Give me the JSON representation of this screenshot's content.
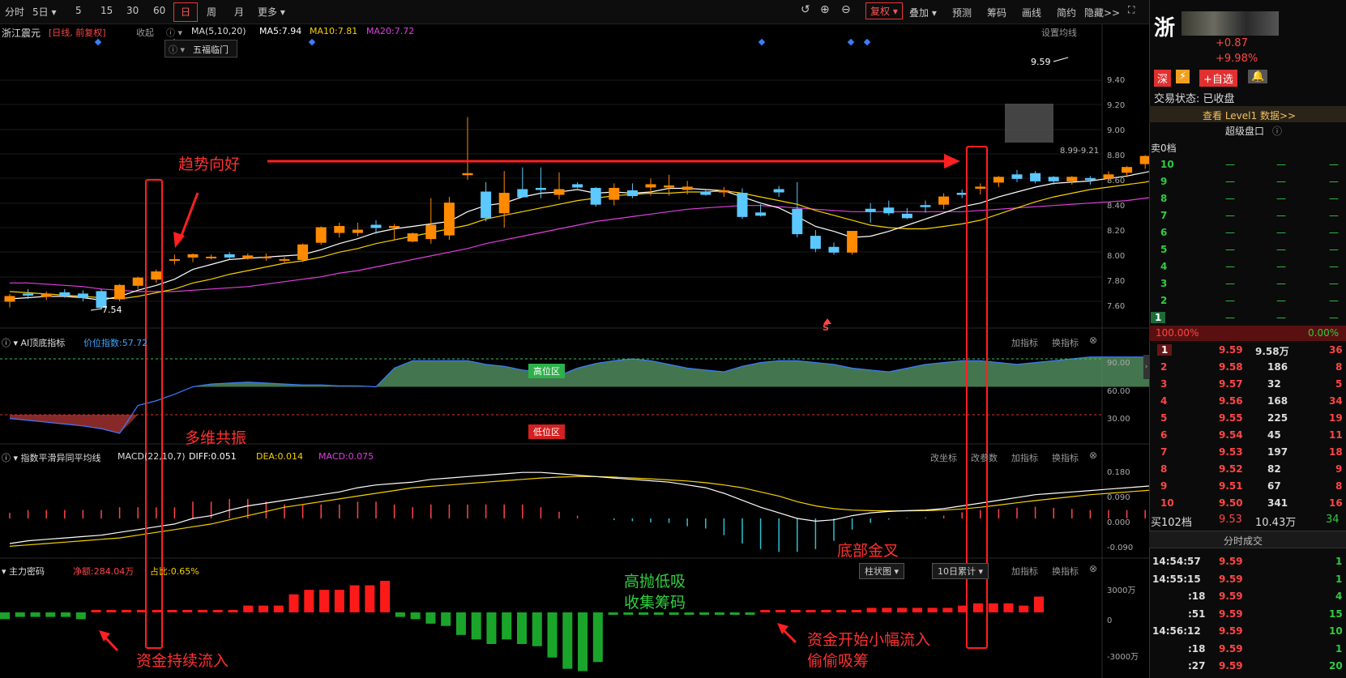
{
  "toolbar": {
    "time_share": "分时",
    "five_day": "5日",
    "m5": "5",
    "m15": "15",
    "m30": "30",
    "m60": "60",
    "day": "日",
    "week": "周",
    "month": "月",
    "more": "更多",
    "fuquan": "复权",
    "overlay": "叠加",
    "predict": "预测",
    "chips": "筹码",
    "draw": "画线",
    "simple": "简约",
    "hide": "隐藏>>"
  },
  "main_chart": {
    "stock_name": "浙江震元",
    "period_note": "[日线, 前复权]",
    "collapse": "收起",
    "ma_label": "MA(5,10,20)",
    "ma5": "MA5:7.94",
    "ma10": "MA10:7.81",
    "ma20": "MA20:7.72",
    "set_ma": "设置均线",
    "wufu": "五福临门",
    "high_label": "9.59",
    "low_label": "7.54",
    "range_label": "8.99-9.21",
    "s_mark": "S",
    "y_ticks": [
      "9.40",
      "9.20",
      "9.00",
      "8.80",
      "8.60",
      "8.40",
      "8.20",
      "8.00",
      "7.80",
      "7.60"
    ]
  },
  "ai_panel": {
    "title": "AI顶底指标",
    "value": "价位指数:57.72",
    "high_zone": "高位区",
    "low_zone": "低位区",
    "add_indicator": "加指标",
    "change_indicator": "换指标",
    "y_ticks": [
      "90.00",
      "60.00",
      "30.00"
    ]
  },
  "macd_panel": {
    "title": "指数平滑异同平均线",
    "param": "MACD(22,10,7)",
    "diff": "DIFF:0.051",
    "dea": "DEA:0.014",
    "macd": "MACD:0.075",
    "change_axis": "改坐标",
    "change_param": "改参数",
    "add_indicator": "加指标",
    "change_indicator": "换指标",
    "y_ticks": [
      "0.180",
      "0.090",
      "0.000",
      "-0.090"
    ]
  },
  "money_panel": {
    "title": "主力密码",
    "net": "净额:284.04万",
    "ratio": "占比:0.65%",
    "bar_select": "柱状图",
    "days_select": "10日累计",
    "add_indicator": "加指标",
    "change_indicator": "换指标",
    "y_ticks": [
      "3000万",
      "0",
      "-3000万"
    ]
  },
  "annotations": {
    "trend": "趋势向好",
    "resonance": "多维共振",
    "inflow": "资金持续流入",
    "high_low_1": "高抛低吸",
    "high_low_2": "收集筹码",
    "golden_cross": "底部金叉",
    "small_inflow_1": "资金开始小幅流入",
    "small_inflow_2": "偷偷吸筹"
  },
  "chart_data": {
    "type": "line",
    "ma_series": [
      {
        "name": "MA5",
        "color": "#ffffff"
      },
      {
        "name": "MA10",
        "color": "#f5d000"
      },
      {
        "name": "MA20",
        "color": "#e040e0"
      }
    ],
    "candles_ohlc": [
      [
        7.6,
        7.66,
        7.55,
        7.64
      ],
      [
        7.66,
        7.7,
        7.62,
        7.65
      ],
      [
        7.64,
        7.68,
        7.61,
        7.66
      ],
      [
        7.67,
        7.7,
        7.63,
        7.65
      ],
      [
        7.66,
        7.69,
        7.6,
        7.63
      ],
      [
        7.68,
        7.7,
        7.54,
        7.55
      ],
      [
        7.62,
        7.74,
        7.6,
        7.73
      ],
      [
        7.73,
        7.8,
        7.7,
        7.79
      ],
      [
        7.78,
        7.86,
        7.75,
        7.84
      ],
      [
        7.94,
        7.98,
        7.9,
        7.94
      ],
      [
        7.96,
        7.99,
        7.92,
        7.98
      ],
      [
        7.96,
        7.98,
        7.94,
        7.96
      ],
      [
        7.98,
        8.0,
        7.94,
        7.96
      ],
      [
        7.95,
        7.99,
        7.94,
        7.97
      ],
      [
        7.96,
        7.99,
        7.93,
        7.96
      ],
      [
        7.94,
        7.96,
        7.91,
        7.94
      ],
      [
        7.94,
        8.07,
        7.92,
        8.06
      ],
      [
        8.08,
        8.21,
        8.06,
        8.2
      ],
      [
        8.16,
        8.24,
        8.12,
        8.21
      ],
      [
        8.16,
        8.24,
        8.13,
        8.18
      ],
      [
        8.22,
        8.26,
        8.15,
        8.2
      ],
      [
        8.2,
        8.23,
        8.1,
        8.21
      ],
      [
        8.09,
        8.16,
        8.08,
        8.15
      ],
      [
        8.11,
        8.44,
        8.07,
        8.22
      ],
      [
        8.14,
        8.45,
        8.1,
        8.4
      ],
      [
        8.63,
        9.1,
        8.59,
        8.64
      ],
      [
        8.49,
        8.57,
        8.25,
        8.28
      ],
      [
        8.32,
        8.66,
        8.2,
        8.48
      ],
      [
        8.51,
        8.69,
        8.46,
        8.45
      ],
      [
        8.52,
        8.69,
        8.44,
        8.51
      ],
      [
        8.47,
        8.65,
        8.43,
        8.51
      ],
      [
        8.55,
        8.57,
        8.52,
        8.53
      ],
      [
        8.52,
        8.53,
        8.37,
        8.39
      ],
      [
        8.43,
        8.56,
        8.38,
        8.52
      ],
      [
        8.5,
        8.56,
        8.44,
        8.46
      ],
      [
        8.53,
        8.6,
        8.46,
        8.55
      ],
      [
        8.53,
        8.63,
        8.46,
        8.54
      ],
      [
        8.51,
        8.58,
        8.47,
        8.53
      ],
      [
        8.49,
        8.51,
        8.46,
        8.47
      ],
      [
        8.49,
        8.53,
        8.45,
        8.5
      ],
      [
        8.48,
        8.52,
        8.27,
        8.29
      ],
      [
        8.32,
        8.39,
        8.29,
        8.3
      ],
      [
        8.51,
        8.54,
        8.45,
        8.49
      ],
      [
        8.35,
        8.57,
        8.12,
        8.15
      ],
      [
        8.13,
        8.18,
        8.0,
        8.03
      ],
      [
        8.04,
        8.08,
        7.98,
        8.0
      ],
      [
        8.0,
        8.17,
        7.98,
        8.17
      ],
      [
        8.35,
        8.4,
        8.24,
        8.33
      ],
      [
        8.36,
        8.42,
        8.3,
        8.32
      ],
      [
        8.31,
        8.36,
        8.27,
        8.28
      ],
      [
        8.38,
        8.42,
        8.32,
        8.37
      ],
      [
        8.39,
        8.48,
        8.35,
        8.45
      ],
      [
        8.48,
        8.51,
        8.44,
        8.47
      ],
      [
        8.52,
        8.56,
        8.47,
        8.53
      ],
      [
        8.57,
        8.62,
        8.53,
        8.61
      ],
      [
        8.63,
        8.67,
        8.57,
        8.6
      ],
      [
        8.64,
        8.66,
        8.56,
        8.58
      ],
      [
        8.61,
        8.62,
        8.55,
        8.58
      ],
      [
        8.58,
        8.62,
        8.55,
        8.61
      ],
      [
        8.6,
        8.62,
        8.55,
        8.59
      ],
      [
        8.6,
        8.66,
        8.58,
        8.63
      ],
      [
        8.65,
        8.7,
        8.61,
        8.69
      ],
      [
        8.72,
        8.79,
        8.68,
        8.78
      ],
      [
        8.84,
        8.87,
        8.71,
        8.74
      ],
      [
        8.86,
        8.9,
        8.66,
        8.73
      ],
      [
        9.59,
        9.59,
        9.21,
        9.21
      ]
    ],
    "ma5": [
      7.62,
      7.63,
      7.64,
      7.64,
      7.63,
      7.61,
      7.64,
      7.69,
      7.73,
      7.78,
      7.86,
      7.9,
      7.94,
      7.95,
      7.96,
      7.97,
      7.98,
      8.02,
      8.07,
      8.11,
      8.16,
      8.19,
      8.21,
      8.23,
      8.25,
      8.33,
      8.38,
      8.4,
      8.45,
      8.48,
      8.49,
      8.51,
      8.48,
      8.49,
      8.48,
      8.49,
      8.52,
      8.52,
      8.51,
      8.5,
      8.45,
      8.4,
      8.36,
      8.29,
      8.21,
      8.17,
      8.12,
      8.13,
      8.17,
      8.22,
      8.27,
      8.32,
      8.37,
      8.4,
      8.45,
      8.49,
      8.53,
      8.56,
      8.57,
      8.58,
      8.6,
      8.62,
      8.65,
      8.68,
      8.72,
      8.83
    ],
    "ma10": [
      7.68,
      7.67,
      7.66,
      7.65,
      7.64,
      7.63,
      7.62,
      7.64,
      7.67,
      7.7,
      7.75,
      7.78,
      7.82,
      7.85,
      7.88,
      7.91,
      7.93,
      7.96,
      8.0,
      8.03,
      8.07,
      8.1,
      8.13,
      8.16,
      8.19,
      8.22,
      8.27,
      8.3,
      8.33,
      8.36,
      8.39,
      8.42,
      8.44,
      8.46,
      8.47,
      8.48,
      8.48,
      8.49,
      8.49,
      8.5,
      8.48,
      8.45,
      8.42,
      8.39,
      8.34,
      8.3,
      8.26,
      8.22,
      8.2,
      8.19,
      8.19,
      8.21,
      8.23,
      8.26,
      8.31,
      8.36,
      8.41,
      8.45,
      8.48,
      8.51,
      8.53,
      8.55,
      8.57,
      8.6,
      8.64,
      8.68
    ],
    "ma20": [
      7.75,
      7.75,
      7.74,
      7.73,
      7.72,
      7.7,
      7.69,
      7.68,
      7.68,
      7.68,
      7.69,
      7.7,
      7.71,
      7.72,
      7.74,
      7.76,
      7.78,
      7.8,
      7.83,
      7.85,
      7.88,
      7.91,
      7.94,
      7.97,
      8.0,
      8.03,
      8.07,
      8.1,
      8.13,
      8.16,
      8.19,
      8.22,
      8.25,
      8.27,
      8.29,
      8.31,
      8.33,
      8.35,
      8.36,
      8.37,
      8.38,
      8.38,
      8.37,
      8.36,
      8.35,
      8.34,
      8.33,
      8.33,
      8.33,
      8.33,
      8.33,
      8.33,
      8.33,
      8.34,
      8.35,
      8.36,
      8.37,
      8.38,
      8.39,
      8.4,
      8.41,
      8.42,
      8.44,
      8.46,
      8.48,
      8.53
    ],
    "ai_index": [
      26,
      24,
      22,
      20,
      18,
      15,
      10,
      40,
      45,
      52,
      60,
      63,
      64,
      65,
      64,
      63,
      62,
      62,
      61,
      61,
      60,
      80,
      88,
      88,
      88,
      88,
      84,
      82,
      78,
      76,
      72,
      80,
      85,
      88,
      90,
      88,
      84,
      80,
      78,
      76,
      82,
      86,
      88,
      88,
      86,
      84,
      80,
      78,
      76,
      80,
      84,
      86,
      88,
      88,
      86,
      84,
      86,
      88,
      90,
      92,
      92,
      92,
      92,
      91,
      91,
      93
    ],
    "diff": [
      -0.09,
      -0.08,
      -0.075,
      -0.07,
      -0.065,
      -0.06,
      -0.05,
      -0.04,
      -0.03,
      -0.02,
      0.0,
      0.01,
      0.03,
      0.045,
      0.055,
      0.065,
      0.075,
      0.085,
      0.095,
      0.11,
      0.12,
      0.125,
      0.13,
      0.14,
      0.145,
      0.15,
      0.155,
      0.16,
      0.165,
      0.165,
      0.16,
      0.155,
      0.15,
      0.145,
      0.14,
      0.135,
      0.13,
      0.12,
      0.11,
      0.09,
      0.065,
      0.04,
      0.02,
      0.0,
      -0.01,
      -0.005,
      0.01,
      0.02,
      0.025,
      0.028,
      0.03,
      0.035,
      0.045,
      0.055,
      0.065,
      0.075,
      0.085,
      0.09,
      0.095,
      0.1,
      0.105,
      0.11,
      0.115,
      0.12,
      0.13,
      0.19
    ],
    "dea": [
      -0.1,
      -0.095,
      -0.09,
      -0.085,
      -0.08,
      -0.075,
      -0.07,
      -0.06,
      -0.05,
      -0.04,
      -0.03,
      -0.02,
      -0.005,
      0.01,
      0.025,
      0.04,
      0.05,
      0.06,
      0.07,
      0.08,
      0.09,
      0.1,
      0.11,
      0.115,
      0.12,
      0.125,
      0.13,
      0.135,
      0.14,
      0.145,
      0.148,
      0.15,
      0.15,
      0.148,
      0.145,
      0.142,
      0.138,
      0.134,
      0.128,
      0.12,
      0.11,
      0.095,
      0.08,
      0.06,
      0.045,
      0.035,
      0.03,
      0.028,
      0.027,
      0.027,
      0.028,
      0.03,
      0.034,
      0.04,
      0.048,
      0.056,
      0.064,
      0.071,
      0.078,
      0.085,
      0.09,
      0.095,
      0.1,
      0.105,
      0.11,
      0.14
    ],
    "money_flow": [
      -3,
      -2,
      -2,
      -2,
      -2,
      -3,
      1,
      1,
      1,
      1,
      1,
      1,
      1,
      1,
      1,
      1,
      3,
      3,
      3,
      8,
      10,
      10,
      10,
      12,
      12,
      14,
      -2,
      -3,
      -5,
      -6,
      -10,
      -12,
      -14,
      -12,
      -14,
      -15,
      -20,
      -25,
      -26,
      -22,
      -1,
      -1,
      -1,
      -1,
      -1,
      -1,
      -1,
      -1,
      -1,
      -1,
      1,
      1,
      1,
      1,
      1,
      1,
      1,
      2,
      2,
      2,
      2,
      2,
      2,
      3,
      4,
      4,
      4,
      3,
      7
    ]
  },
  "right_panel": {
    "name_char": "浙",
    "change": "+0.87",
    "change_pct": "+9.98%",
    "exchange": "深",
    "add_fav": "+自选",
    "trade_status": "交易状态: 已收盘",
    "level1": "查看 Level1 数据>>",
    "super_book": "超级盘口",
    "sell_header": "卖0档",
    "sell_levels": [
      "10",
      "9",
      "8",
      "7",
      "6",
      "5",
      "4",
      "3",
      "2",
      "1"
    ],
    "dash": "—",
    "pct_left": "100.00%",
    "pct_right": "0.00%",
    "buy_rows": [
      {
        "lvl": "1",
        "price": "9.59",
        "vol": "9.58万",
        "cnt": "36"
      },
      {
        "lvl": "2",
        "price": "9.58",
        "vol": "186",
        "cnt": "8"
      },
      {
        "lvl": "3",
        "price": "9.57",
        "vol": "32",
        "cnt": "5"
      },
      {
        "lvl": "4",
        "price": "9.56",
        "vol": "168",
        "cnt": "34"
      },
      {
        "lvl": "5",
        "price": "9.55",
        "vol": "225",
        "cnt": "19"
      },
      {
        "lvl": "6",
        "price": "9.54",
        "vol": "45",
        "cnt": "11"
      },
      {
        "lvl": "7",
        "price": "9.53",
        "vol": "197",
        "cnt": "18"
      },
      {
        "lvl": "8",
        "price": "9.52",
        "vol": "82",
        "cnt": "9"
      },
      {
        "lvl": "9",
        "price": "9.51",
        "vol": "67",
        "cnt": "8"
      },
      {
        "lvl": "10",
        "price": "9.50",
        "vol": "341",
        "cnt": "16"
      }
    ],
    "buy_total": {
      "label": "买102档",
      "price": "9.53",
      "vol": "10.43万",
      "cnt": "34"
    },
    "trades_title": "分时成交",
    "trades": [
      {
        "t": "14:54:57",
        "p": "9.59",
        "v": "1"
      },
      {
        "t": "14:55:15",
        "p": "9.59",
        "v": "1"
      },
      {
        "t": ":18",
        "p": "9.59",
        "v": "4"
      },
      {
        "t": ":51",
        "p": "9.59",
        "v": "15"
      },
      {
        "t": "14:56:12",
        "p": "9.59",
        "v": "10"
      },
      {
        "t": ":18",
        "p": "9.59",
        "v": "1"
      },
      {
        "t": ":27",
        "p": "9.59",
        "v": "20"
      }
    ]
  }
}
